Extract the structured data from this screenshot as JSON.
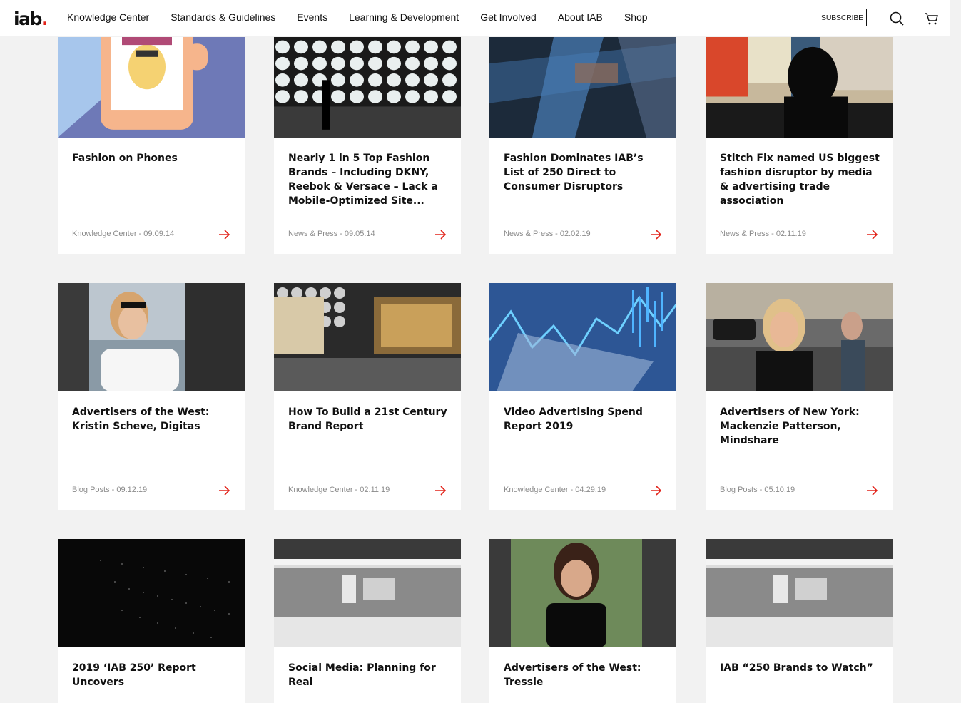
{
  "brand": {
    "logo_text": "iab",
    "logo_dot": ".",
    "accent": "#e2231a"
  },
  "nav": {
    "items": [
      "Knowledge Center",
      "Standards & Guidelines",
      "Events",
      "Learning & Development",
      "Get Involved",
      "About IAB",
      "Shop"
    ],
    "subscribe_label": "SUBSCRIBE"
  },
  "icons": {
    "search": "search-icon",
    "cart": "cart-icon",
    "arrow": "arrow-right-icon"
  },
  "cards": [
    {
      "title": "Fashion on Phones",
      "meta": "Knowledge Center - 09.09.14"
    },
    {
      "title": "Nearly 1 in 5 Top Fashion Brands – Including DKNY, Reebok & Versace – Lack a Mobile-Optimized Site...",
      "meta": "News & Press - 09.05.14"
    },
    {
      "title": "Fashion Dominates IAB’s List of 250 Direct to Consumer Disruptors",
      "meta": "News & Press - 02.02.19"
    },
    {
      "title": "Stitch Fix named US biggest fashion disruptor by media & advertising trade association",
      "meta": "News & Press - 02.11.19"
    },
    {
      "title": "Advertisers of the West: Kristin Scheve, Digitas",
      "meta": "Blog Posts - 09.12.19"
    },
    {
      "title": "How To Build a 21st Century Brand Report",
      "meta": "Knowledge Center - 02.11.19"
    },
    {
      "title": "Video Advertising Spend Report 2019",
      "meta": "Knowledge Center - 04.29.19"
    },
    {
      "title": "Advertisers of New York: Mackenzie Patterson, Mindshare",
      "meta": "Blog Posts - 05.10.19"
    },
    {
      "title": "2019 ‘IAB 250’ Report Uncovers",
      "meta": ""
    },
    {
      "title": "Social Media: Planning for Real",
      "meta": ""
    },
    {
      "title": "Advertisers of the West: Tressie",
      "meta": ""
    },
    {
      "title": "IAB “250 Brands to Watch”",
      "meta": ""
    }
  ]
}
